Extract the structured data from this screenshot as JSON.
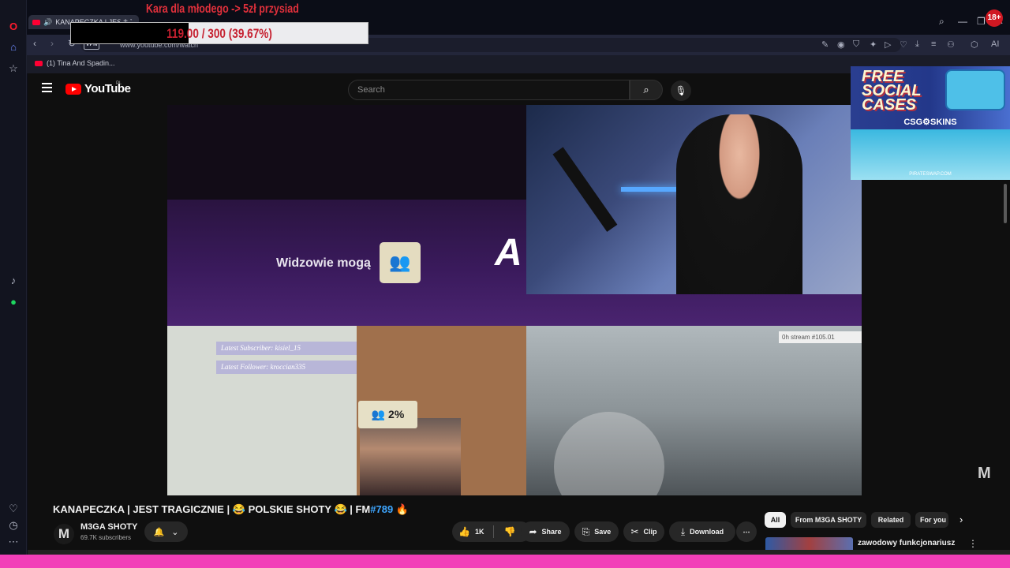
{
  "browser": {
    "tab_title": "KANAPECZKA | JEST T...",
    "tab_add": "+",
    "url": "www.youtube.com/watch",
    "vpn": "VPN",
    "bookmark": "(1) Tina And Spadin...",
    "window_controls": {
      "search": "⌕",
      "minimize": "—",
      "maximize": "❐",
      "close": "✕"
    },
    "toolbar_ai": "AI"
  },
  "overlay": {
    "goal_title": "Kara dla młodego -> 5zł przysiad",
    "goal_progress_text": "119.00 / 300 (39.67%)",
    "goal_progress_fraction": 0.3967,
    "badge": "18+"
  },
  "youtube": {
    "logo_text": "YouTube",
    "country": "PL",
    "search_placeholder": "Search",
    "video": {
      "widzowie_text": "Widzowie mogą",
      "percent_badge": "2%",
      "latest_subscriber": "Latest Subscriber: kisiel_15",
      "latest_follower": "Latest Follower: kroccian335",
      "stream_tag": "0h stream   #105.01",
      "watermark": "M"
    },
    "ad": {
      "headline_1": "FREE",
      "headline_2": "SOCIAL",
      "headline_3": "CASES",
      "brand": "CSG⚙SKINS",
      "footer": "PIRATESWAP.COM"
    },
    "title_main": "KANAPECZKA | JEST TRAGICZNIE | 😂 POLSKIE SHOTY 😂 | FM",
    "title_hash": "#789",
    "title_end": " 🔥",
    "channel": {
      "avatar": "M",
      "name": "M3GA SHOTY",
      "subscribers": "69.7K subscribers"
    },
    "actions": {
      "likes": "1K",
      "share": "Share",
      "save": "Save",
      "clip": "Clip",
      "download": "Download",
      "more": "⋯"
    },
    "chips": [
      "All",
      "From M3GA SHOTY",
      "Related",
      "For you"
    ],
    "recommended": {
      "title": "zawodowy funkcjonariusz"
    }
  }
}
